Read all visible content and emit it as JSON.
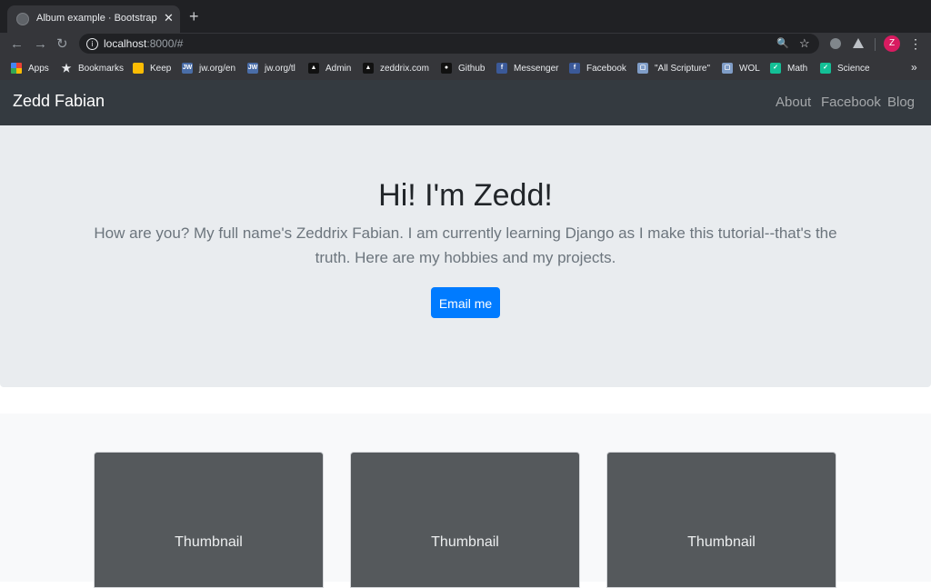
{
  "browser": {
    "tab_title": "Album example · Bootstrap",
    "tab_close": "✕",
    "new_tab": "+",
    "back": "←",
    "forward": "→",
    "reload": "↻",
    "url_host": "localhost",
    "url_rest": ":8000/#",
    "zoom_icon": "🔍",
    "star_icon": "☆",
    "profile_initial": "Z",
    "menu": "⋮",
    "bookmarks_more": "»"
  },
  "bookmarks": [
    {
      "label": "Apps",
      "icon": "apps-grid-icon",
      "icon_text": "",
      "color": "#ea4335"
    },
    {
      "label": "Bookmarks",
      "icon": "star-icon",
      "icon_text": "★",
      "color": "transparent"
    },
    {
      "label": "Keep",
      "icon": "keep-icon",
      "icon_text": "",
      "color": "#fbbc04"
    },
    {
      "label": "jw.org/en",
      "icon": "jw-icon",
      "icon_text": "JW",
      "color": "#4a6da7"
    },
    {
      "label": "jw.org/tl",
      "icon": "jw-icon",
      "icon_text": "JW",
      "color": "#4a6da7"
    },
    {
      "label": "Admin",
      "icon": "admin-icon",
      "icon_text": "▲",
      "color": "#111111"
    },
    {
      "label": "zeddrix.com",
      "icon": "zeddrix-icon",
      "icon_text": "▲",
      "color": "#111111"
    },
    {
      "label": "Github",
      "icon": "github-icon",
      "icon_text": "●",
      "color": "#111111"
    },
    {
      "label": "Messenger",
      "icon": "facebook-icon",
      "icon_text": "f",
      "color": "#3b5998"
    },
    {
      "label": "Facebook",
      "icon": "facebook-icon",
      "icon_text": "f",
      "color": "#3b5998"
    },
    {
      "label": "\"All Scripture\"",
      "icon": "book-icon",
      "icon_text": "▢",
      "color": "#7f9cc6"
    },
    {
      "label": "WOL",
      "icon": "book-icon",
      "icon_text": "▢",
      "color": "#7f9cc6"
    },
    {
      "label": "Math",
      "icon": "khan-icon",
      "icon_text": "✓",
      "color": "#14bf96"
    },
    {
      "label": "Science",
      "icon": "khan-icon",
      "icon_text": "✓",
      "color": "#14bf96"
    }
  ],
  "navbar": {
    "brand": "Zedd Fabian",
    "links": [
      "About",
      "Facebook",
      "Blog"
    ]
  },
  "hero": {
    "title": "Hi! I'm Zedd!",
    "lead": "How are you? My full name's Zeddrix Fabian. I am currently learning Django as I make this tutorial--that's the truth. Here are my hobbies and my projects.",
    "button": "Email me"
  },
  "cards": [
    {
      "label": "Thumbnail"
    },
    {
      "label": "Thumbnail"
    },
    {
      "label": "Thumbnail"
    }
  ],
  "colors": {
    "navbar_bg": "#343a40",
    "jumbotron_bg": "#e9ecef",
    "primary": "#007bff",
    "thumbnail_bg": "#55595c"
  }
}
